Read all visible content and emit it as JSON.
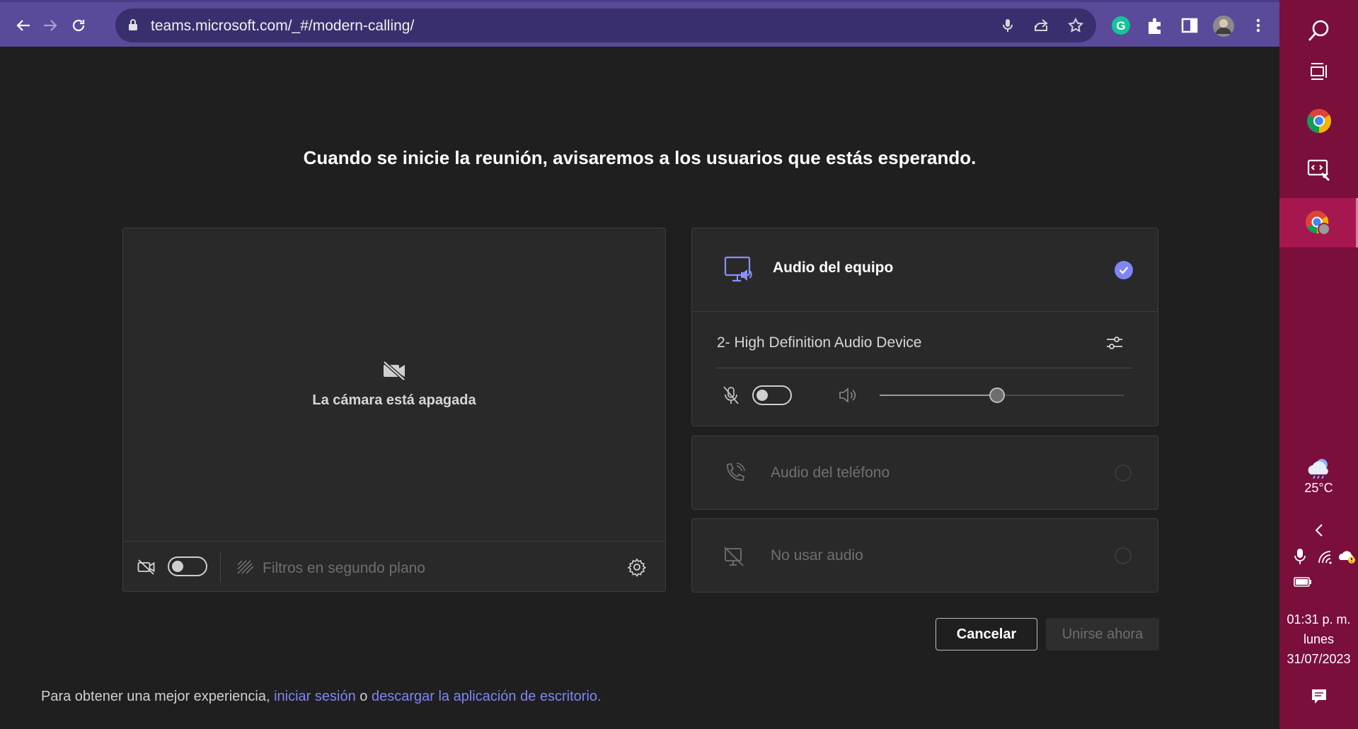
{
  "browser": {
    "url": "teams.microsoft.com/_#/modern-calling/",
    "colors": {
      "toolbar": "#5b4a9a",
      "omnibox": "#3a2f6e",
      "accent": "#7f85f5"
    }
  },
  "page": {
    "headline": "Cuando se inicie la reunión, avisaremos a los usuarios que estás esperando.",
    "video": {
      "camera_off_text": "La cámara está apagada",
      "filters_label": "Filtros en segundo plano"
    },
    "audio": {
      "computer_audio_label": "Audio del equipo",
      "device_name": "2- High Definition Audio Device",
      "volume_level": 0.48,
      "phone_audio_label": "Audio del teléfono",
      "no_audio_label": "No usar audio"
    },
    "buttons": {
      "cancel": "Cancelar",
      "join": "Unirse ahora"
    },
    "footer": {
      "prefix": "Para obtener una mejor experiencia, ",
      "signin_link": "iniciar sesión",
      "middle": " o ",
      "download_link": "descargar la aplicación de escritorio",
      "suffix": "."
    }
  },
  "taskbar": {
    "weather_temp": "25°C",
    "time": "01:31 p. m.",
    "day": "lunes",
    "date": "31/07/2023"
  }
}
